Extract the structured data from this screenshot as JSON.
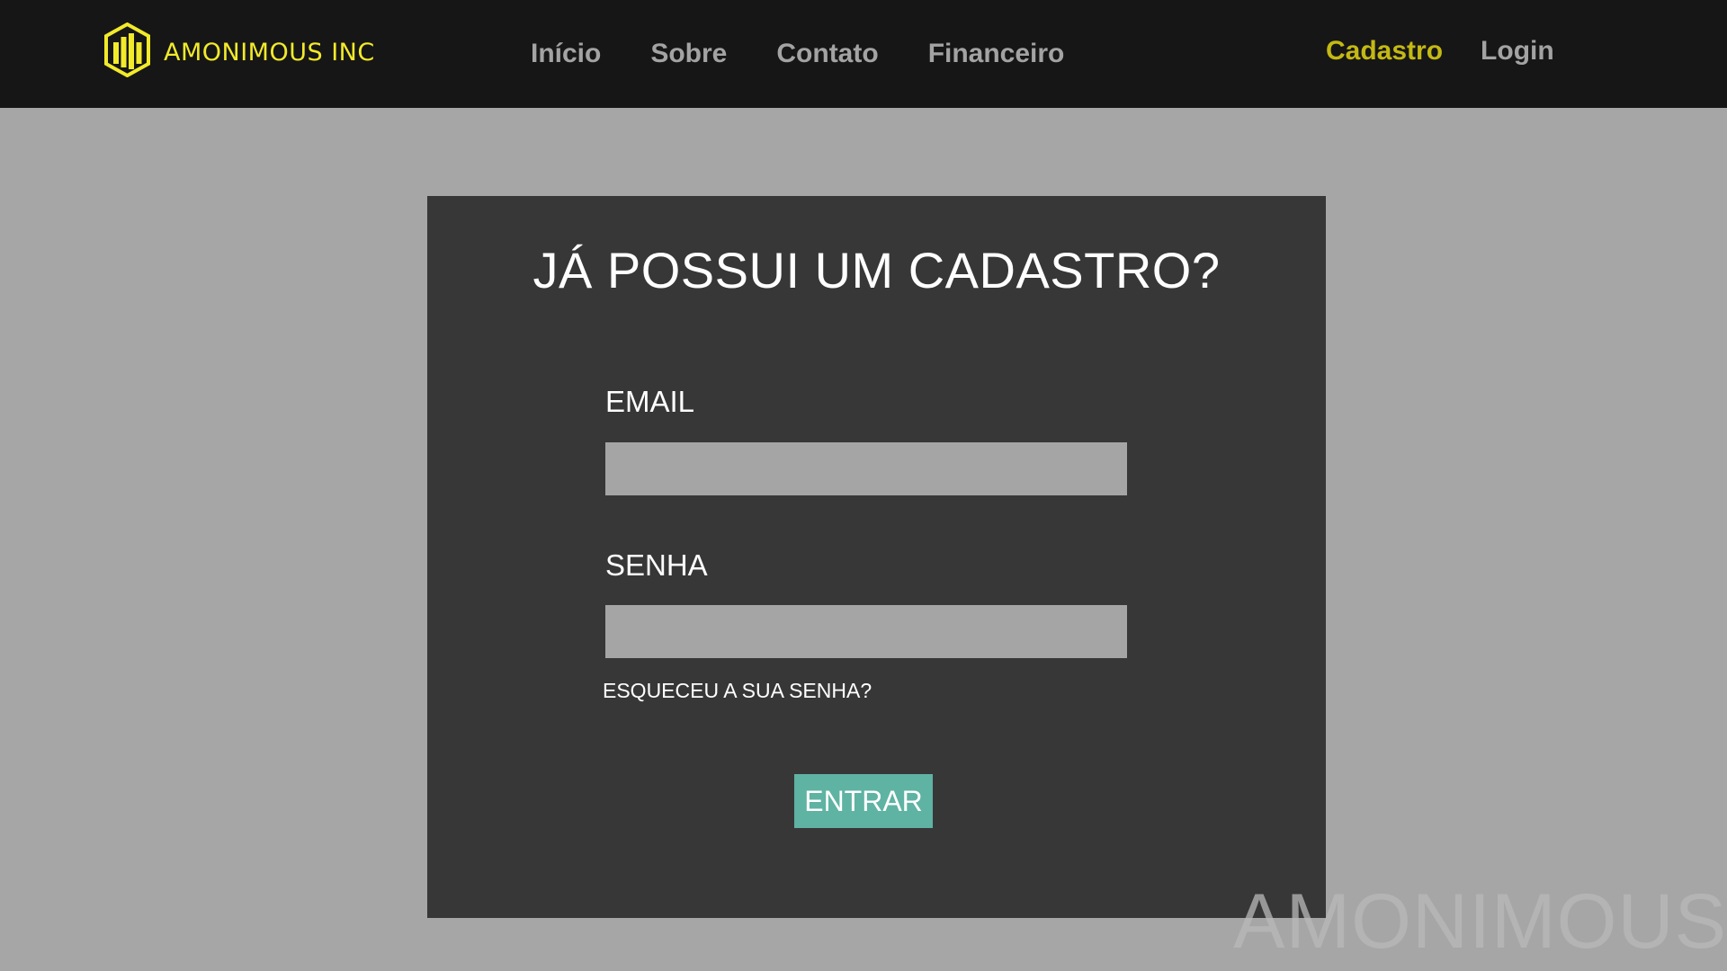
{
  "header": {
    "brand": "AMONIMOUS INC",
    "brand_color": "#f2ea2a",
    "nav": [
      {
        "label": "Início"
      },
      {
        "label": "Sobre"
      },
      {
        "label": "Contato"
      },
      {
        "label": "Financeiro"
      }
    ],
    "auth": {
      "cadastro": "Cadastro",
      "login": "Login",
      "active": "Cadastro",
      "active_color": "#c4b913"
    }
  },
  "login_form": {
    "title": "JÁ POSSUI UM CADASTRO?",
    "email_label": "EMAIL",
    "email_value": "",
    "password_label": "SENHA",
    "password_value": "",
    "forgot_link": "ESQUECEU A SUA SENHA?",
    "submit_label": "ENTRAR",
    "submit_color": "#5fb3a3"
  },
  "watermark": "AMONIMOUS",
  "colors": {
    "navbar_bg": "#161616",
    "page_bg": "#a6a6a6",
    "card_bg": "#373737",
    "input_bg": "#a5a5a5"
  }
}
